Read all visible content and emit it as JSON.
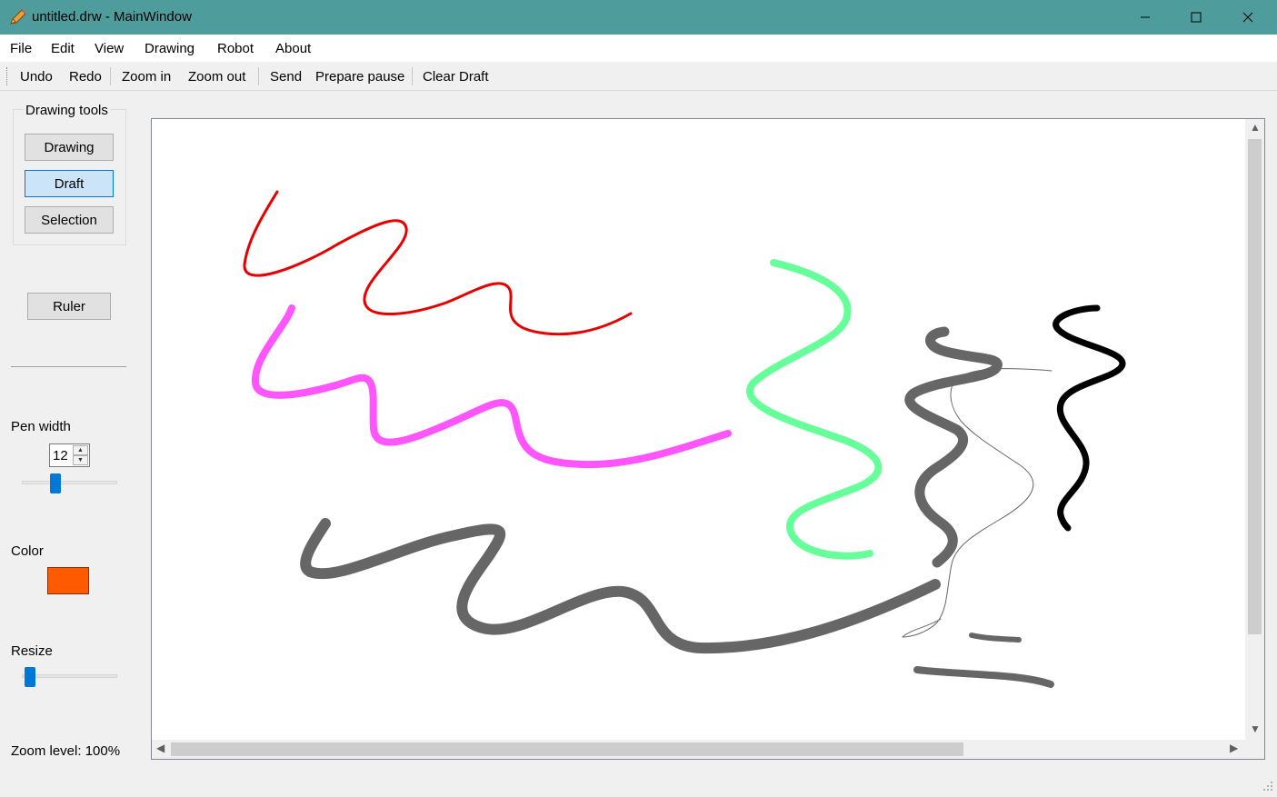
{
  "window": {
    "title": "untitled.drw - MainWindow"
  },
  "menu": [
    "File",
    "Edit",
    "View",
    "Drawing",
    "Robot",
    "About"
  ],
  "toolbar": {
    "undo": "Undo",
    "redo": "Redo",
    "zoom_in": "Zoom in",
    "zoom_out": "Zoom out",
    "send": "Send",
    "prepare_pause": "Prepare pause",
    "clear_draft": "Clear Draft"
  },
  "tools": {
    "group_title": "Drawing tools",
    "drawing": "Drawing",
    "draft": "Draft",
    "selection": "Selection",
    "active": "Draft",
    "ruler": "Ruler"
  },
  "pen_width": {
    "label": "Pen width",
    "value": "12",
    "slider_fraction": 0.33
  },
  "color": {
    "label": "Color",
    "value": "#ff5a00"
  },
  "resize": {
    "label": "Resize",
    "slider_fraction": 0.03
  },
  "zoom": {
    "label": "Zoom level: 100%"
  },
  "strokes": [
    {
      "color": "#e60000"
    },
    {
      "color": "#ff55ff"
    },
    {
      "color": "#66ff99"
    },
    {
      "color": "#666666"
    },
    {
      "color": "#000000"
    }
  ],
  "icons": {
    "app": "pencil-icon",
    "minimize": "minimize-icon",
    "maximize": "maximize-icon",
    "close": "close-icon"
  }
}
